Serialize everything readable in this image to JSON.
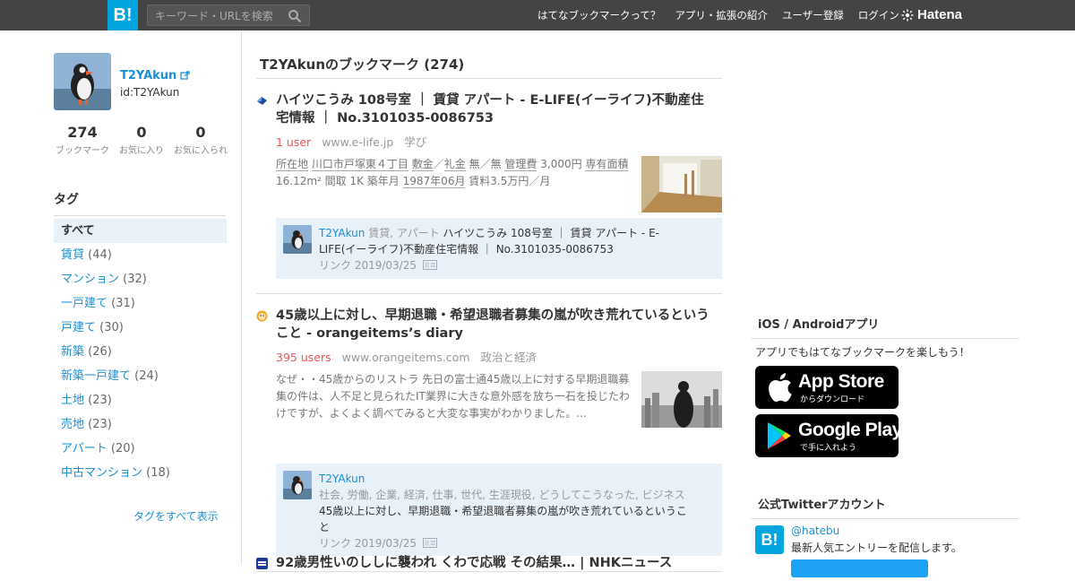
{
  "header": {
    "logo": "B!",
    "search_placeholder": "キーワード・URLを検索",
    "nav": [
      "はてなブックマークって？",
      "アプリ・拡張の紹介",
      "ユーザー登録",
      "ログイン"
    ],
    "brand": "Hatena"
  },
  "profile": {
    "name": "T2YAkun",
    "id": "id:T2YAkun",
    "stats": [
      {
        "num": "274",
        "label": "ブックマーク"
      },
      {
        "num": "0",
        "label": "お気に入り"
      },
      {
        "num": "0",
        "label": "お気に入られ"
      }
    ]
  },
  "tags": {
    "heading": "タグ",
    "items": [
      {
        "label": "すべて",
        "count": ""
      },
      {
        "label": "賃貸",
        "count": "(44)"
      },
      {
        "label": "マンション",
        "count": "(32)"
      },
      {
        "label": "一戸建て",
        "count": "(31)"
      },
      {
        "label": "戸建て",
        "count": "(30)"
      },
      {
        "label": "新築",
        "count": "(26)"
      },
      {
        "label": "新築一戸建て",
        "count": "(24)"
      },
      {
        "label": "土地",
        "count": "(23)"
      },
      {
        "label": "売地",
        "count": "(23)"
      },
      {
        "label": "アパート",
        "count": "(20)"
      },
      {
        "label": "中古マンション",
        "count": "(18)"
      }
    ],
    "all_link": "タグをすべて表示"
  },
  "main": {
    "title": "T2YAkunのブックマーク (274)",
    "entries": [
      {
        "title": "ハイツこうみ 108号室 ｜ 賃貸 アパート - E-LIFE(イーライフ)不動産住宅情報 ｜ No.3101035-0086753",
        "users": "1 user",
        "domain": "www.e-life.jp",
        "category": "学び",
        "desc_line1_a": "所在地",
        "desc_line1_b": "川口市戸塚東４丁目",
        "desc_line1_c": "敷金",
        "desc_line1_d": "／",
        "desc_line1_e": "礼金",
        "desc_line1_f": "無／無",
        "desc_line1_g": "管理費",
        "desc_line1_h": "3,000円",
        "desc_line1_i": "専有面積",
        "desc_line2": "16.12m² 間取 1K 築年月",
        "desc_line2_b": "1987年06月",
        "desc_line2_c": "賃料3.5万円／月",
        "comment_user": "T2YAkun",
        "comment_tags": "賃貸, アパート",
        "comment_text": "ハイツこうみ 108号室 ｜ 賃貸 アパート - E-LIFE(イーライフ)不動産住宅情報 ｜ No.3101035-0086753",
        "comment_date": "リンク 2019/03/25"
      },
      {
        "title": "45歳以上に対し、早期退職・希望退職者募集の嵐が吹き荒れているということ - orangeitems’s diary",
        "users": "395 users",
        "domain": "www.orangeitems.com",
        "category": "政治と経済",
        "desc": "なぜ・・45歳からのリストラ 先日の富士通45歳以上に対する早期退職募集の件は、人不足と見られたIT業界に大きな意外感を放ち一石を投じたわけですが、よくよく調べてみると大変な事実がわかりました。...",
        "comment_user": "T2YAkun",
        "comment_tags": "社会, 労働, 企業, 経済, 仕事, 世代, 生涯現役, どうしてこうなった, ビジネス",
        "comment_text": "45歳以上に対し、早期退職・希望退職者募集の嵐が吹き荒れているということ",
        "comment_date": "リンク 2019/03/25"
      },
      {
        "title": "92歳男性いのししに襲われ くわで応戦 その結果… | NHKニュース"
      }
    ]
  },
  "right": {
    "apps_heading": "iOS / Androidアプリ",
    "apps_text": "アプリでもはてなブックマークを楽しもう！",
    "appstore_big": "App Store",
    "appstore_small": "からダウンロード",
    "gplay_big": "Google Play",
    "gplay_small": "で手に入れよう",
    "twitter_heading": "公式Twitterアカウント",
    "twitter_handle": "@hatebu",
    "twitter_desc": "最新人気エントリーを配信します。"
  },
  "colors": {
    "header_bg": "#444444",
    "brand_blue": "#00a4de",
    "link": "#1a8fd3",
    "users_red": "#ee5555",
    "comment_bg": "#e8f0f8"
  }
}
